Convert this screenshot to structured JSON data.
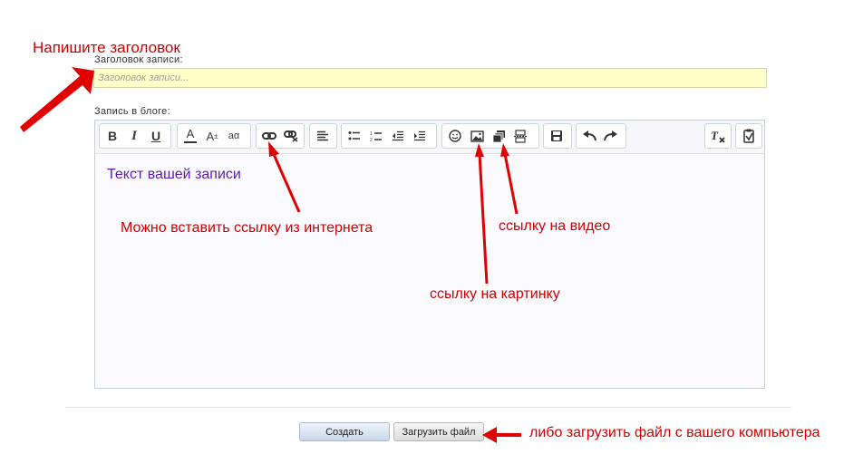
{
  "annotations": {
    "title_hint": "Напишите заголовок",
    "link_hint": "Можно вставить ссылку из интернета",
    "video_hint": "ссылку на видео",
    "image_hint": "ссылку на картинку",
    "upload_hint": "либо загрузить файл с вашего компьютера"
  },
  "form": {
    "title_label": "Заголовок записи:",
    "title_placeholder": "Заголовок записи...",
    "body_label": "Запись в блоге:",
    "body_text": "Текст вашей записи"
  },
  "toolbar": {
    "bold": "B",
    "italic": "I",
    "underline": "U",
    "text_color": "A",
    "font_size": "A",
    "font_size_sup": "±",
    "case": "aα",
    "icons": [
      "bold-icon",
      "italic-icon",
      "underline-icon",
      "text-color-icon",
      "font-size-icon",
      "text-case-icon",
      "link-icon",
      "unlink-icon",
      "align-left-icon",
      "bulleted-list-icon",
      "numbered-list-icon",
      "outdent-icon",
      "indent-icon",
      "smiley-icon",
      "image-icon",
      "video-icon",
      "page-break-icon",
      "save-icon",
      "undo-icon",
      "redo-icon",
      "clear-formatting-icon",
      "paste-word-icon"
    ]
  },
  "buttons": {
    "create": "Создать",
    "upload": "Загрузить файл"
  },
  "colors": {
    "annotation": "#d20000",
    "editor_text": "#5b1bb0",
    "title_input_bg": "#ffffc8"
  }
}
